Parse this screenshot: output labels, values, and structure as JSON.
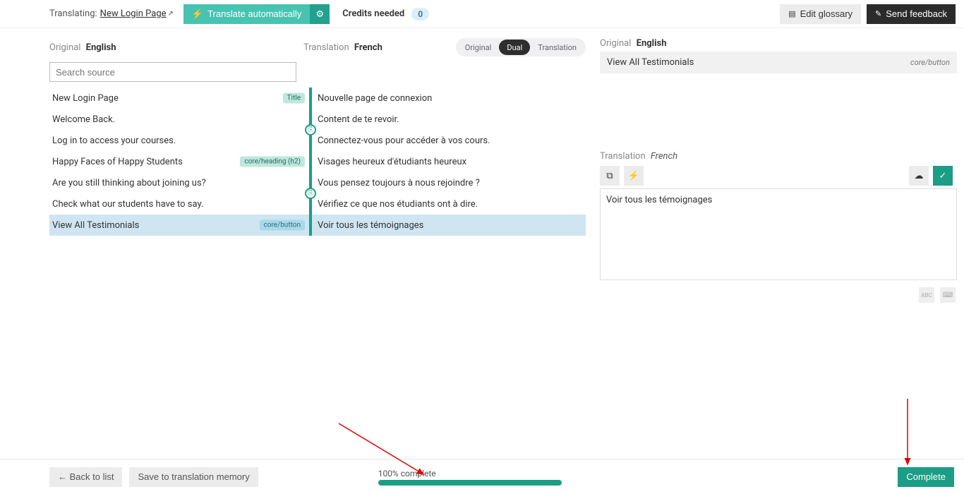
{
  "header": {
    "translating_label": "Translating:",
    "page_link": "New Login Page",
    "auto_btn": "Translate automatically",
    "credits_label": "Credits needed",
    "credits_value": "0",
    "glossary_btn": "Edit glossary",
    "feedback_btn": "Send feedback"
  },
  "left": {
    "original_label": "Original",
    "original_lang": "English",
    "translation_label": "Translation",
    "translation_lang": "French",
    "view_tabs": {
      "original": "Original",
      "dual": "Dual",
      "translation": "Translation"
    },
    "search_placeholder": "Search source"
  },
  "rows": [
    {
      "src": "New Login Page",
      "tag": "Title",
      "tgt": "Nouvelle page de connexion",
      "link": false,
      "selected": false
    },
    {
      "src": "Welcome Back.",
      "tag": "",
      "tgt": "Content de te revoir.",
      "link": false,
      "selected": false
    },
    {
      "src": "Log in to access your courses.",
      "tag": "",
      "tgt": "Connectez-vous pour accéder à vos cours.",
      "link": true,
      "selected": false
    },
    {
      "src": "Happy Faces of Happy Students",
      "tag": "core/heading (h2)",
      "tgt": "Visages heureux d'étudiants heureux",
      "link": false,
      "selected": false
    },
    {
      "src": "Are you still thinking about joining us?",
      "tag": "",
      "tgt": "Vous pensez toujours à nous rejoindre ?",
      "link": false,
      "selected": false
    },
    {
      "src": "Check what our students have to say.",
      "tag": "",
      "tgt": "Vérifiez ce que nos étudiants ont à dire.",
      "link": true,
      "selected": false
    },
    {
      "src": "View All Testimonials",
      "tag": "core/button",
      "tgt": "Voir tous les témoignages",
      "link": false,
      "selected": true
    }
  ],
  "right": {
    "original_label": "Original",
    "original_lang": "English",
    "original_text": "View All Testimonials",
    "original_type": "core/button",
    "translation_label": "Translation",
    "translation_lang": "French",
    "translation_text": "Voir tous les témoignages",
    "abc": "ABC"
  },
  "footer": {
    "back": "← Back to list",
    "save_tm": "Save to translation memory",
    "progress_label": "100% complete",
    "complete_btn": "Complete"
  }
}
